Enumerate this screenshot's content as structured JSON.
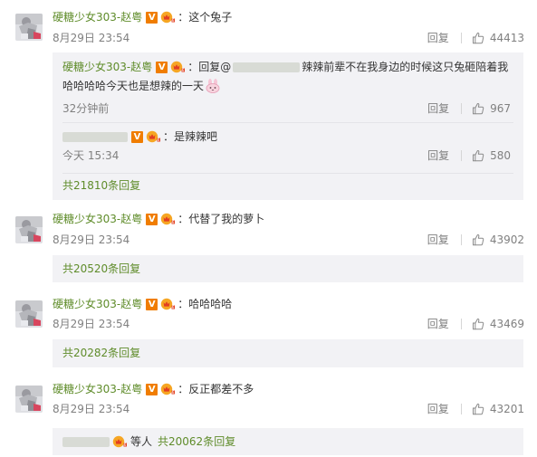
{
  "comments": [
    {
      "user": "硬糖少女303-赵粤",
      "text": "这个兔子",
      "time": "8月29日 23:54",
      "reply_label": "回复",
      "likes": "44413",
      "replies": [
        {
          "user": "硬糖少女303-赵粤",
          "prefix": "回复@",
          "text_line1": "辣辣前辈不在我身边的时候这只兔砸陪着我",
          "text_line2": "哈哈哈哈今天也是想辣的一天",
          "time": "32分钟前",
          "reply_label": "回复",
          "likes": "967"
        },
        {
          "text": "是辣辣吧",
          "time": "今天 15:34",
          "reply_label": "回复",
          "likes": "580"
        }
      ],
      "more": "共21810条回复"
    },
    {
      "user": "硬糖少女303-赵粤",
      "text": "代替了我的萝卜",
      "time": "8月29日 23:54",
      "reply_label": "回复",
      "likes": "43902",
      "more": "共20520条回复"
    },
    {
      "user": "硬糖少女303-赵粤",
      "text": "哈哈哈哈",
      "time": "8月29日 23:54",
      "reply_label": "回复",
      "likes": "43469",
      "more": "共20282条回复"
    },
    {
      "user": "硬糖少女303-赵粤",
      "text": "反正都差不多",
      "time": "8月29日 23:54",
      "reply_label": "回复",
      "likes": "43201",
      "others_label": "等人",
      "more": "共20062条回复"
    }
  ],
  "badges": {
    "v": "V"
  },
  "colors": {
    "username": "#5f8c2a",
    "meta": "#808080",
    "subbox": "#f2f2f5",
    "vbadge": "#f07d00"
  },
  "icons": {
    "thumb": "thumbs-up-icon",
    "vip": "vip-crown-icon",
    "bunny": "bunny-emoji-icon"
  }
}
